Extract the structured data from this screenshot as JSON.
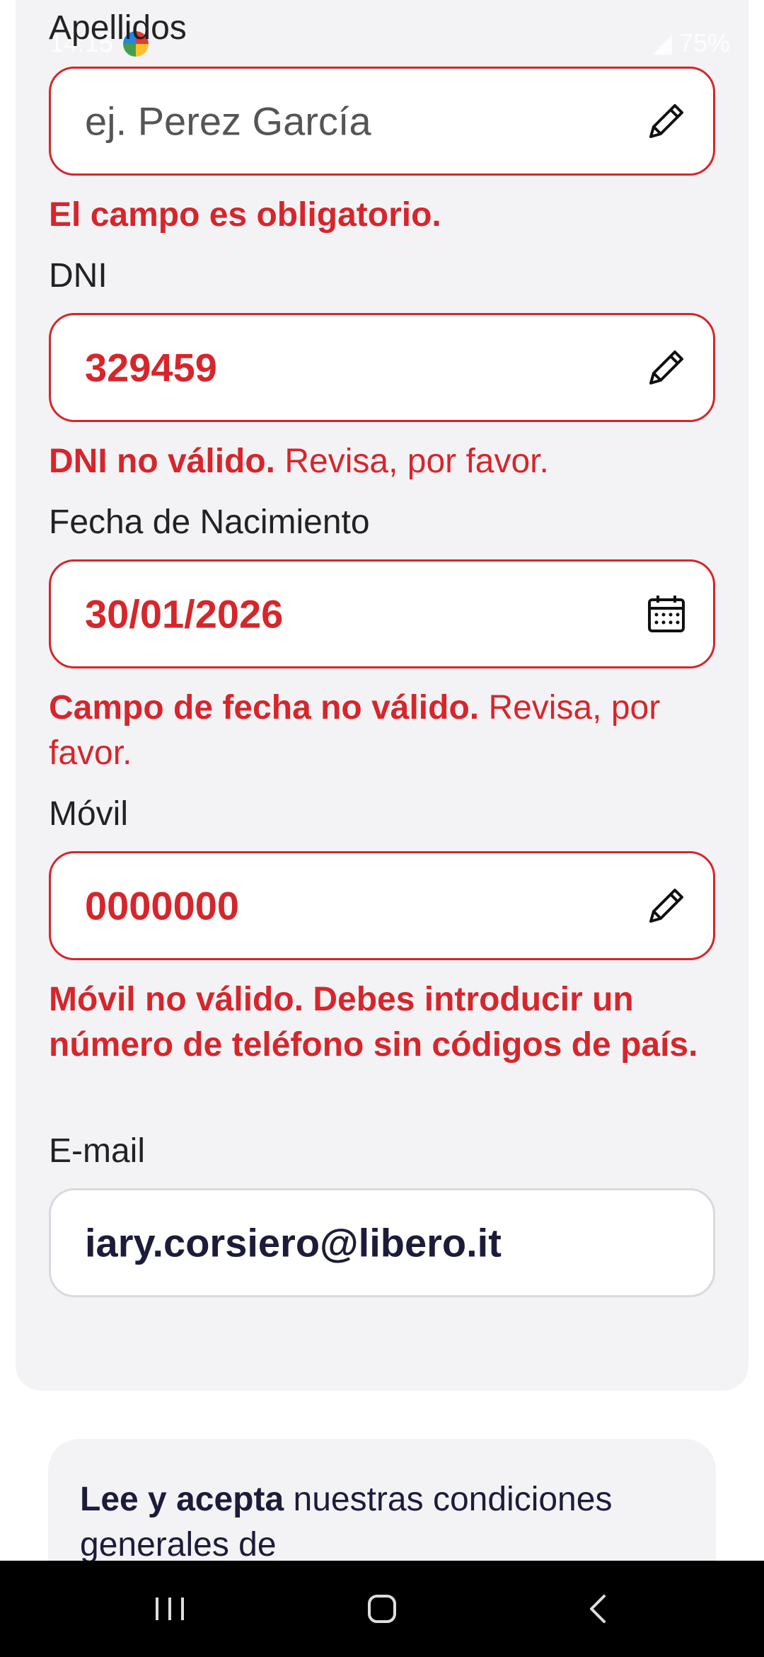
{
  "status_bar": {
    "time": "14:15",
    "battery": "75%"
  },
  "form": {
    "apellidos": {
      "label": "Apellidos",
      "placeholder": "ej. Perez García",
      "error": "El campo es obligatorio."
    },
    "dni": {
      "label": "DNI",
      "value": "329459",
      "error_bold": "DNI no válido.",
      "error_rest": " Revisa, por favor."
    },
    "fecha": {
      "label": "Fecha de Nacimiento",
      "value": "30/01/2026",
      "error_bold": "Campo de fecha no válido.",
      "error_rest": " Revisa, por favor."
    },
    "movil": {
      "label": "Móvil",
      "value": "0000000",
      "error": "Móvil no válido. Debes introducir un número de teléfono sin códigos de país."
    },
    "email": {
      "label": "E-mail",
      "value": "iary.corsiero@libero.it"
    }
  },
  "terms": {
    "bold": "Lee y acepta",
    "rest": " nuestras condiciones generales de"
  },
  "colors": {
    "error": "#d6262b",
    "text_dark": "#1c1c3a",
    "card_bg": "#f3f3f6"
  },
  "icons": [
    "pencil-icon",
    "calendar-icon",
    "recent-apps-icon",
    "home-icon",
    "back-icon"
  ]
}
